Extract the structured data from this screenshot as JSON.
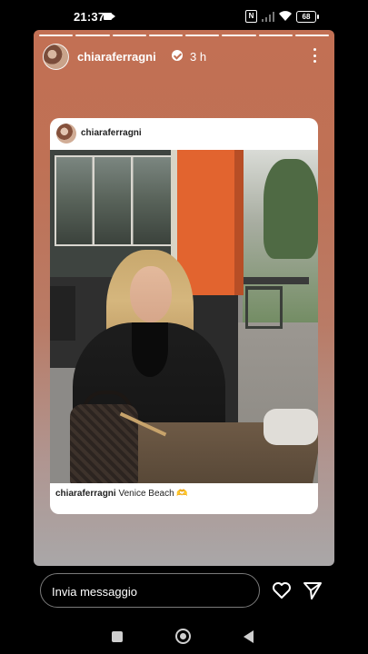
{
  "status_bar": {
    "time": "21:37",
    "battery": "68",
    "nfc": "N"
  },
  "story": {
    "progress_segments": 8,
    "active_segment": 8,
    "username": "chiaraferragni",
    "verified": true,
    "time_ago": "3 h"
  },
  "post": {
    "username": "chiaraferragni",
    "caption_user": "chiaraferragni",
    "caption_text": "Venice Beach 🫶"
  },
  "reply": {
    "placeholder": "Invia messaggio"
  },
  "colors": {
    "story_top": "#c27054",
    "story_bottom": "#a9a7a8",
    "accent_orange": "#e2642f"
  },
  "icons": {
    "more": "more-vertical-icon",
    "like": "heart-icon",
    "send": "send-icon",
    "verified": "verified-badge-icon"
  }
}
